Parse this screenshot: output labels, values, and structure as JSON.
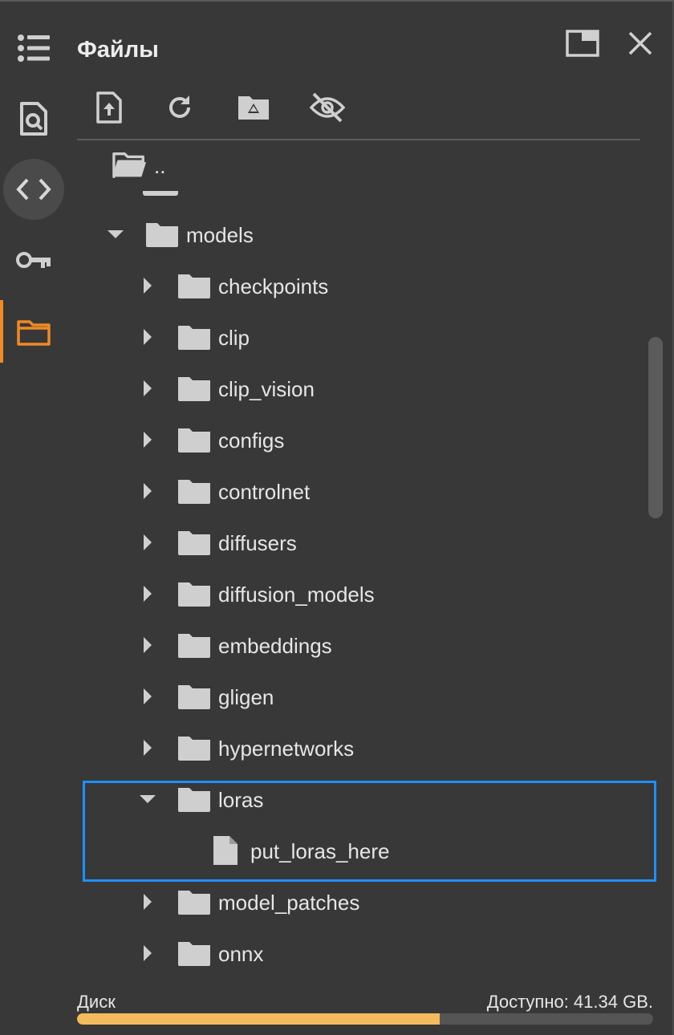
{
  "panel": {
    "title": "Файлы"
  },
  "toolbar": {
    "upload": "upload-file-icon",
    "refresh": "refresh-icon",
    "drive": "drive-icon",
    "hidden": "toggle-hidden-icon"
  },
  "tree": {
    "parent_label": "..",
    "models_label": "models",
    "children": [
      {
        "label": "checkpoints",
        "expanded": false
      },
      {
        "label": "clip",
        "expanded": false
      },
      {
        "label": "clip_vision",
        "expanded": false
      },
      {
        "label": "configs",
        "expanded": false
      },
      {
        "label": "controlnet",
        "expanded": false
      },
      {
        "label": "diffusers",
        "expanded": false
      },
      {
        "label": "diffusion_models",
        "expanded": false
      },
      {
        "label": "embeddings",
        "expanded": false
      },
      {
        "label": "gligen",
        "expanded": false
      },
      {
        "label": "hypernetworks",
        "expanded": false
      },
      {
        "label": "loras",
        "expanded": true
      },
      {
        "label": "model_patches",
        "expanded": false
      },
      {
        "label": "onnx",
        "expanded": false
      }
    ],
    "loras_file": "put_loras_here"
  },
  "disk": {
    "label": "Диск",
    "free": "Доступно: 41.34 GB.",
    "used_fraction": 0.63
  },
  "colors": {
    "accent": "#f08a24",
    "highlight": "#1f8fff",
    "disk_fill": "#f4bb5c"
  }
}
